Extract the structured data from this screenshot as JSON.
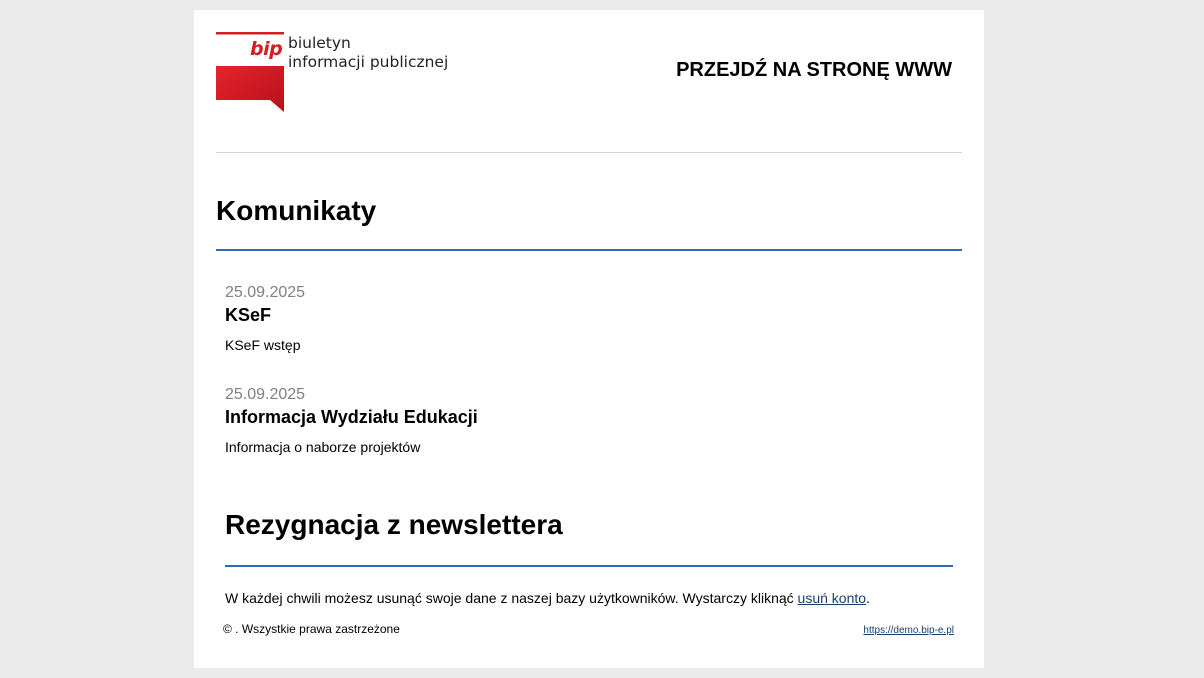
{
  "header": {
    "logo": {
      "mark_text": "bip",
      "line1": "biuletyn",
      "line2": "informacji publicznej"
    },
    "www_link": "PRZEJDŹ NA STRONĘ WWW"
  },
  "announcements": {
    "heading": "Komunikaty",
    "items": [
      {
        "date": "25.09.2025",
        "title": "KSeF",
        "lead": "KSeF wstęp"
      },
      {
        "date": "25.09.2025",
        "title": "Informacja Wydziału Edukacji",
        "lead": "Informacja o naborze projektów"
      }
    ]
  },
  "unsubscribe": {
    "heading": "Rezygnacja z newslettera",
    "text": "W każdej chwili możesz usunąć swoje dane z naszej bazy użytkowników. Wystarczy kliknąć ",
    "link": "usuń konto",
    "suffix": "."
  },
  "footer": {
    "copyright": "© . Wszystkie prawa zastrzeżone",
    "url": "https://demo.bip-e.pl"
  },
  "colors": {
    "page_background": "#ebebeb",
    "sheet_background": "#ffffff",
    "accent_red": "#d11f26",
    "rule_blue": "#2b6cb0",
    "link_blue": "#1a3e73",
    "date_gray": "#808080"
  }
}
